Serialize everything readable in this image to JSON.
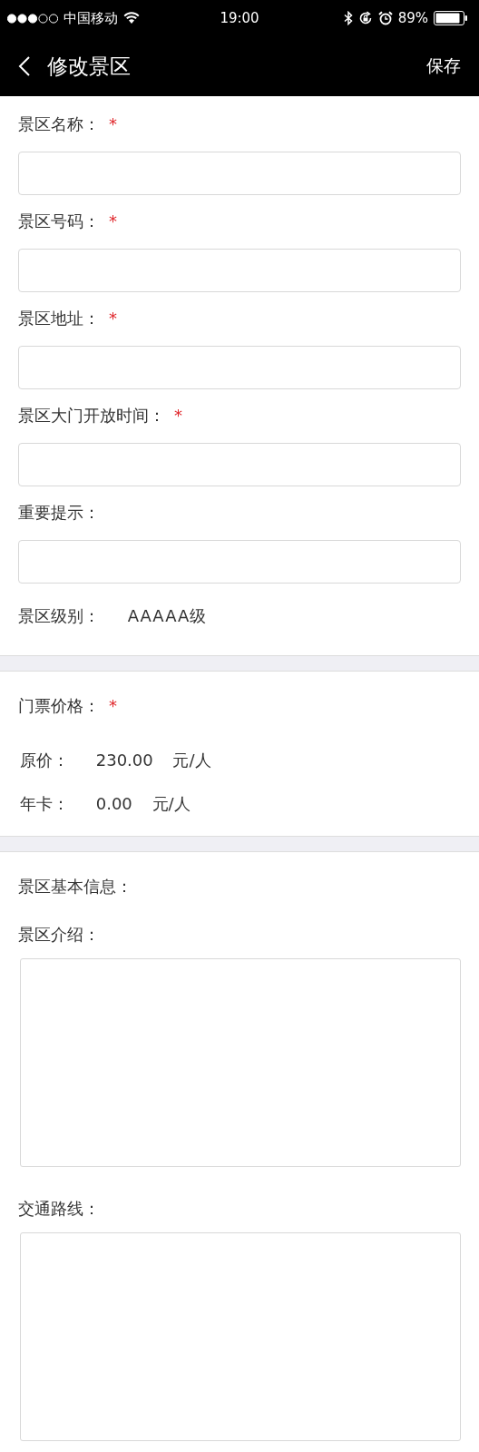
{
  "status_bar": {
    "carrier": "中国移动",
    "time": "19:00",
    "battery": "89%"
  },
  "nav": {
    "title": "修改景区",
    "action": "保存"
  },
  "basic_fields": [
    {
      "label": "景区名称：",
      "required_mark": "*"
    },
    {
      "label": "景区号码：",
      "required_mark": "*"
    },
    {
      "label": "景区地址：",
      "required_mark": "*"
    },
    {
      "label": "景区大门开放时间：",
      "required_mark": "*"
    },
    {
      "label": "重要提示："
    }
  ],
  "level": {
    "label": "景区级别：",
    "value": "AAAAA级"
  },
  "price": {
    "label": "门票价格：",
    "required_mark": "*",
    "rows": [
      {
        "label": "原价：",
        "amount": "230.00",
        "unit": "元/人"
      },
      {
        "label": "年卡：",
        "amount": "0.00",
        "unit": "元/人"
      }
    ]
  },
  "info": {
    "title": "景区基本信息：",
    "areas": [
      {
        "label": "景区介绍："
      },
      {
        "label": "交通路线："
      }
    ]
  }
}
